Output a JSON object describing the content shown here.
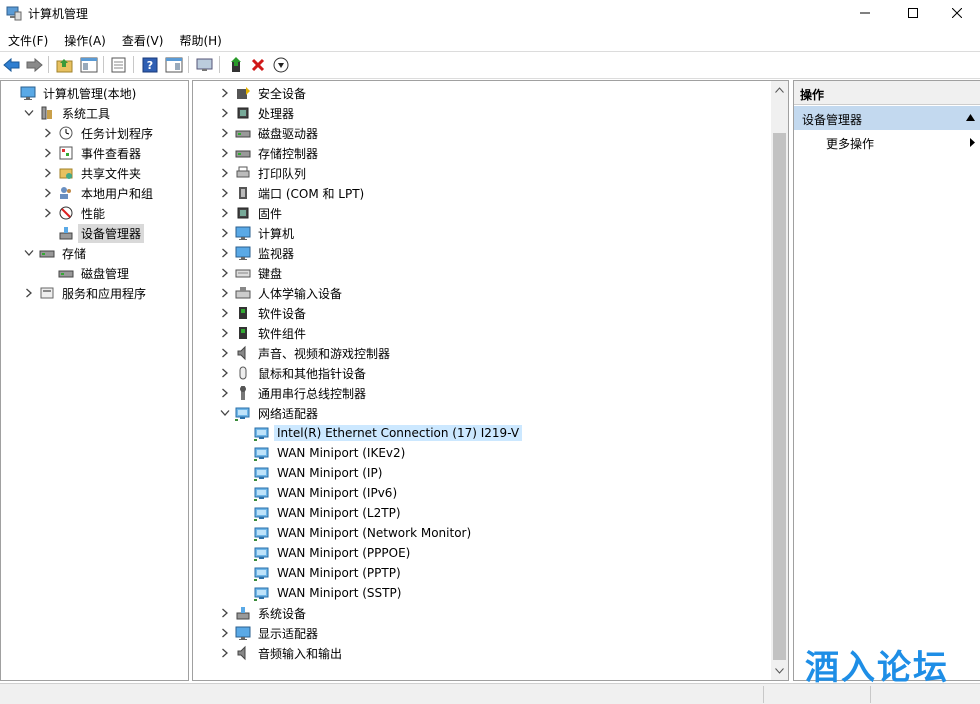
{
  "window": {
    "title": "计算机管理",
    "min_icon": "minimize-icon",
    "max_icon": "maximize-icon",
    "close_icon": "close-icon"
  },
  "menu": [
    "文件(F)",
    "操作(A)",
    "查看(V)",
    "帮助(H)"
  ],
  "left_tree": [
    {
      "label": "计算机管理(本地)",
      "icon": "computer-management-icon",
      "level": 0,
      "arrow": ""
    },
    {
      "label": "系统工具",
      "icon": "system-tools-icon",
      "level": 1,
      "arrow": "down"
    },
    {
      "label": "任务计划程序",
      "icon": "task-scheduler-icon",
      "level": 2,
      "arrow": "right"
    },
    {
      "label": "事件查看器",
      "icon": "event-viewer-icon",
      "level": 2,
      "arrow": "right"
    },
    {
      "label": "共享文件夹",
      "icon": "shared-folder-icon",
      "level": 2,
      "arrow": "right"
    },
    {
      "label": "本地用户和组",
      "icon": "users-icon",
      "level": 2,
      "arrow": "right"
    },
    {
      "label": "性能",
      "icon": "performance-icon",
      "level": 2,
      "arrow": "right"
    },
    {
      "label": "设备管理器",
      "icon": "device-manager-icon",
      "level": 2,
      "arrow": "",
      "selected": true
    },
    {
      "label": "存储",
      "icon": "storage-icon",
      "level": 1,
      "arrow": "down"
    },
    {
      "label": "磁盘管理",
      "icon": "disk-management-icon",
      "level": 2,
      "arrow": ""
    },
    {
      "label": "服务和应用程序",
      "icon": "services-icon",
      "level": 1,
      "arrow": "right"
    }
  ],
  "device_tree": [
    {
      "label": "安全设备",
      "icon": "security-device-icon",
      "level": 0,
      "arrow": "right"
    },
    {
      "label": "处理器",
      "icon": "processor-icon",
      "level": 0,
      "arrow": "right"
    },
    {
      "label": "磁盘驱动器",
      "icon": "disk-drive-icon",
      "level": 0,
      "arrow": "right"
    },
    {
      "label": "存储控制器",
      "icon": "storage-controller-icon",
      "level": 0,
      "arrow": "right"
    },
    {
      "label": "打印队列",
      "icon": "printer-icon",
      "level": 0,
      "arrow": "right"
    },
    {
      "label": "端口 (COM 和 LPT)",
      "icon": "port-icon",
      "level": 0,
      "arrow": "right"
    },
    {
      "label": "固件",
      "icon": "firmware-icon",
      "level": 0,
      "arrow": "right"
    },
    {
      "label": "计算机",
      "icon": "computer-icon",
      "level": 0,
      "arrow": "right"
    },
    {
      "label": "监视器",
      "icon": "monitor-icon",
      "level": 0,
      "arrow": "right"
    },
    {
      "label": "键盘",
      "icon": "keyboard-icon",
      "level": 0,
      "arrow": "right"
    },
    {
      "label": "人体学输入设备",
      "icon": "hid-icon",
      "level": 0,
      "arrow": "right"
    },
    {
      "label": "软件设备",
      "icon": "software-device-icon",
      "level": 0,
      "arrow": "right"
    },
    {
      "label": "软件组件",
      "icon": "software-component-icon",
      "level": 0,
      "arrow": "right"
    },
    {
      "label": "声音、视频和游戏控制器",
      "icon": "sound-icon",
      "level": 0,
      "arrow": "right"
    },
    {
      "label": "鼠标和其他指针设备",
      "icon": "mouse-icon",
      "level": 0,
      "arrow": "right"
    },
    {
      "label": "通用串行总线控制器",
      "icon": "usb-icon",
      "level": 0,
      "arrow": "right"
    },
    {
      "label": "网络适配器",
      "icon": "network-adapter-icon",
      "level": 0,
      "arrow": "down"
    },
    {
      "label": "Intel(R) Ethernet Connection (17) I219-V",
      "icon": "network-adapter-icon",
      "level": 1,
      "arrow": "",
      "selected": true
    },
    {
      "label": "WAN Miniport (IKEv2)",
      "icon": "network-adapter-icon",
      "level": 1,
      "arrow": ""
    },
    {
      "label": "WAN Miniport (IP)",
      "icon": "network-adapter-icon",
      "level": 1,
      "arrow": ""
    },
    {
      "label": "WAN Miniport (IPv6)",
      "icon": "network-adapter-icon",
      "level": 1,
      "arrow": ""
    },
    {
      "label": "WAN Miniport (L2TP)",
      "icon": "network-adapter-icon",
      "level": 1,
      "arrow": ""
    },
    {
      "label": "WAN Miniport (Network Monitor)",
      "icon": "network-adapter-icon",
      "level": 1,
      "arrow": ""
    },
    {
      "label": "WAN Miniport (PPPOE)",
      "icon": "network-adapter-icon",
      "level": 1,
      "arrow": ""
    },
    {
      "label": "WAN Miniport (PPTP)",
      "icon": "network-adapter-icon",
      "level": 1,
      "arrow": ""
    },
    {
      "label": "WAN Miniport (SSTP)",
      "icon": "network-adapter-icon",
      "level": 1,
      "arrow": ""
    },
    {
      "label": "系统设备",
      "icon": "system-device-icon",
      "level": 0,
      "arrow": "right"
    },
    {
      "label": "显示适配器",
      "icon": "display-adapter-icon",
      "level": 0,
      "arrow": "right"
    },
    {
      "label": "音频输入和输出",
      "icon": "audio-io-icon",
      "level": 0,
      "arrow": "right"
    }
  ],
  "actions": {
    "header": "操作",
    "section": "设备管理器",
    "more": "更多操作"
  },
  "watermark": "酒入论坛",
  "colors": {
    "selected_blue": "#cce8ff",
    "selected_gray": "#d9d9d9",
    "action_section": "#c3d9ef",
    "watermark": "#1e8ee6"
  }
}
